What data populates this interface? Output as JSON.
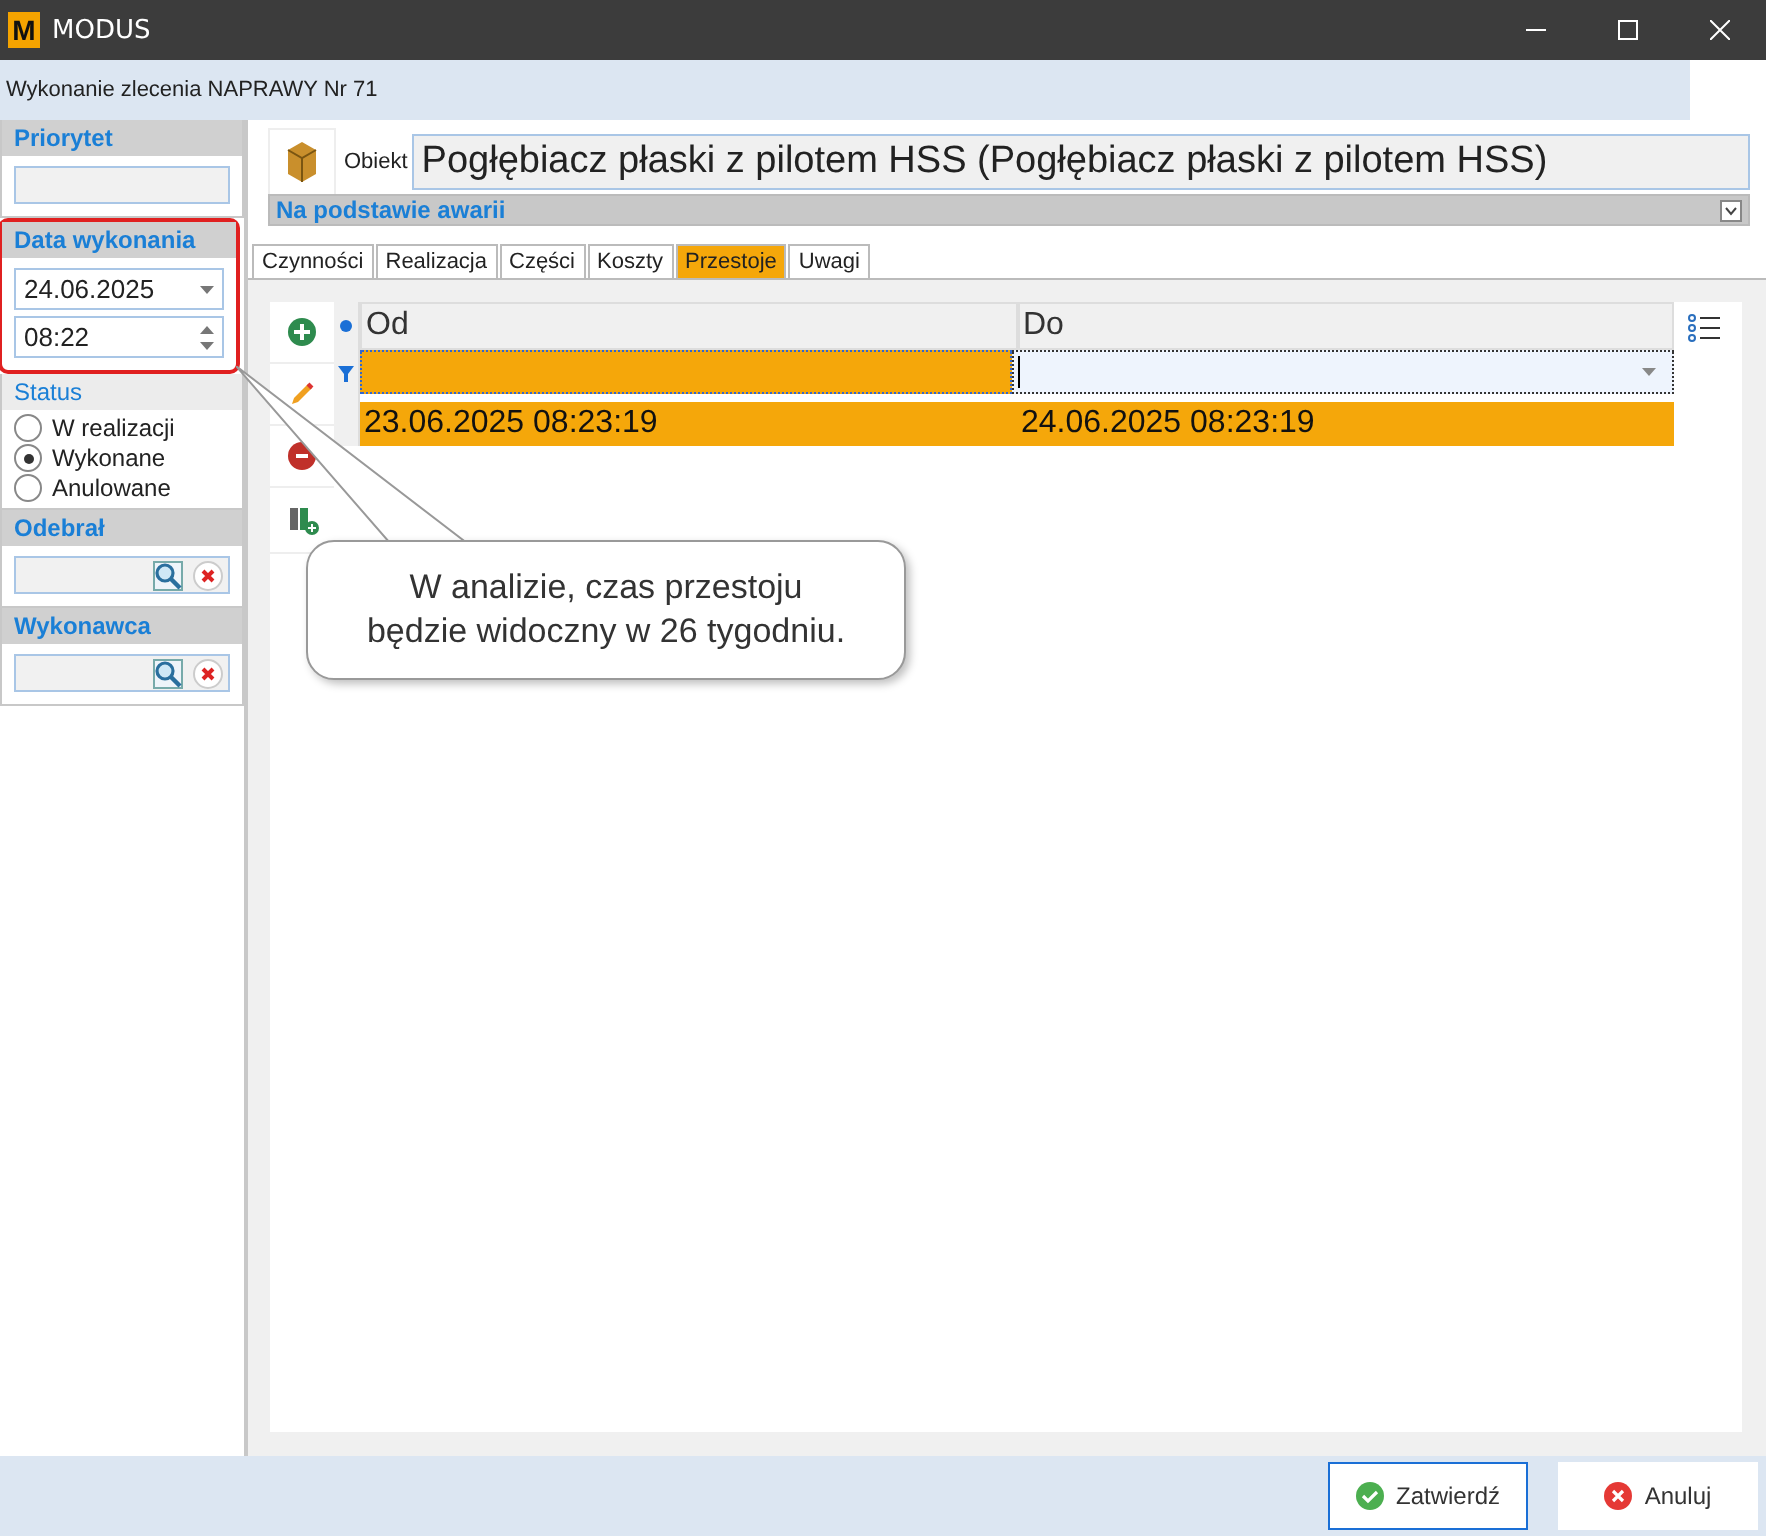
{
  "window": {
    "title": "MODUS",
    "logo": "M"
  },
  "header": "Wykonanie zlecenia NAPRAWY Nr 71",
  "left": {
    "priority": {
      "label": "Priorytet"
    },
    "date": {
      "label": "Data wykonania",
      "date": "24.06.2025",
      "time": "08:22",
      "highlighted": true
    },
    "status": {
      "label": "Status",
      "options": [
        {
          "label": "W realizacji",
          "selected": false
        },
        {
          "label": "Wykonane",
          "selected": true
        },
        {
          "label": "Anulowane",
          "selected": false
        }
      ]
    },
    "received": {
      "label": "Odebrał"
    },
    "performer": {
      "label": "Wykonawca"
    }
  },
  "object": {
    "label": "Obiekt",
    "value": "Pogłębiacz płaski z pilotem HSS (Pogłębiacz płaski z pilotem HSS)"
  },
  "section": "Na podstawie awarii",
  "tabs": [
    {
      "label": "Czynności",
      "selected": false
    },
    {
      "label": "Realizacja",
      "selected": false
    },
    {
      "label": "Części",
      "selected": false
    },
    {
      "label": "Koszty",
      "selected": false
    },
    {
      "label": "Przestoje",
      "selected": true
    },
    {
      "label": "Uwagi",
      "selected": false
    }
  ],
  "grid": {
    "columns": [
      "Od",
      "Do"
    ],
    "rows": [
      [
        "23.06.2025 08:23:19",
        "24.06.2025 08:23:19"
      ]
    ]
  },
  "callout": "W analizie, czas przestoju\nbędzie widoczny w 26 tygodniu.",
  "buttons": [
    {
      "label": "Zatwierdź",
      "kind": "confirm"
    },
    {
      "label": "Anuluj",
      "kind": "cancel"
    }
  ]
}
